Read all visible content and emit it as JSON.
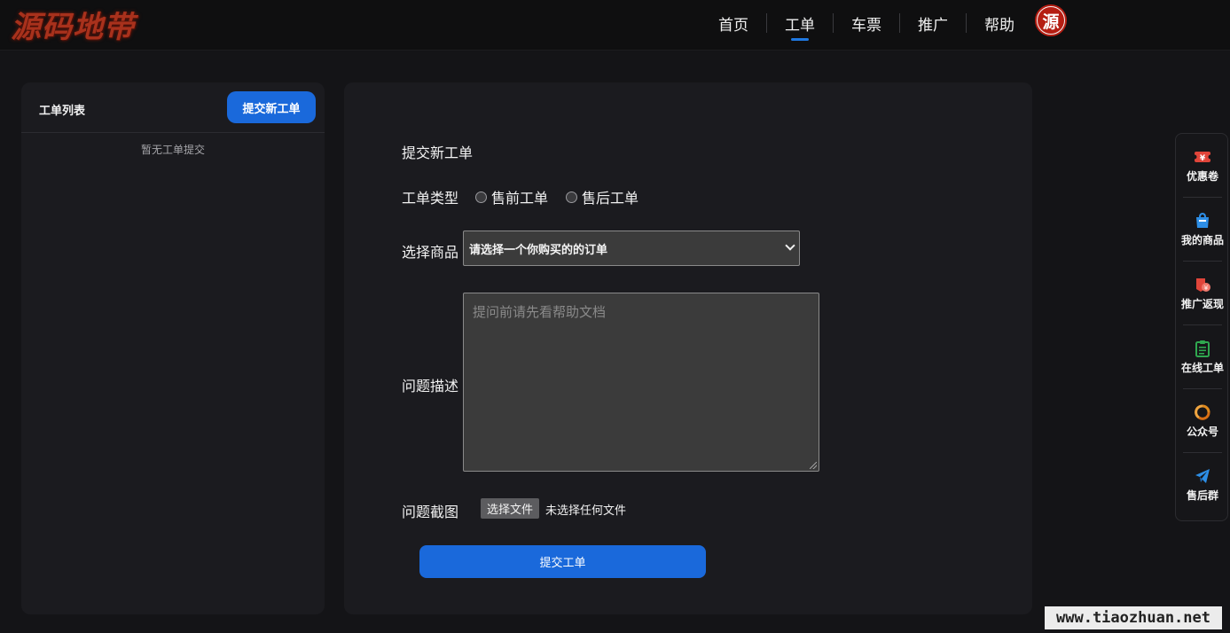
{
  "header": {
    "logo_text": "源码地带",
    "nav": [
      {
        "label": "首页",
        "active": false
      },
      {
        "label": "工单",
        "active": true
      },
      {
        "label": "车票",
        "active": false
      },
      {
        "label": "推广",
        "active": false
      },
      {
        "label": "帮助",
        "active": false
      }
    ],
    "avatar_text": "源"
  },
  "ticket_list": {
    "title": "工单列表",
    "new_button": "提交新工单",
    "empty_text": "暂无工单提交"
  },
  "form": {
    "title": "提交新工单",
    "type_label": "工单类型",
    "type_options": [
      "售前工单",
      "售后工单"
    ],
    "product_label": "选择商品",
    "product_select_value": "请选择一个你购买的的订单",
    "desc_label": "问题描述",
    "desc_placeholder": "提问前请先看帮助文档",
    "screenshot_label": "问题截图",
    "file_button": "选择文件",
    "file_status": "未选择任何文件",
    "submit_button": "提交工单"
  },
  "sidebar": {
    "items": [
      {
        "label": "优惠卷",
        "icon": "coupon-icon",
        "color": "#e0453a"
      },
      {
        "label": "我的商品",
        "icon": "shopping-bag-icon",
        "color": "#2d8ee6"
      },
      {
        "label": "推广返现",
        "icon": "cashback-icon",
        "color": "#e0453a"
      },
      {
        "label": "在线工单",
        "icon": "clipboard-icon",
        "color": "#2fa84f"
      },
      {
        "label": "公众号",
        "icon": "wechat-official-icon",
        "color": "#e08a1e"
      },
      {
        "label": "售后群",
        "icon": "telegram-icon",
        "color": "#2d8ee6"
      }
    ]
  },
  "watermark": "www.tiaozhuan.net",
  "colors": {
    "accent": "#1a69db",
    "background": "#141417",
    "panel": "#1b1b1f"
  }
}
